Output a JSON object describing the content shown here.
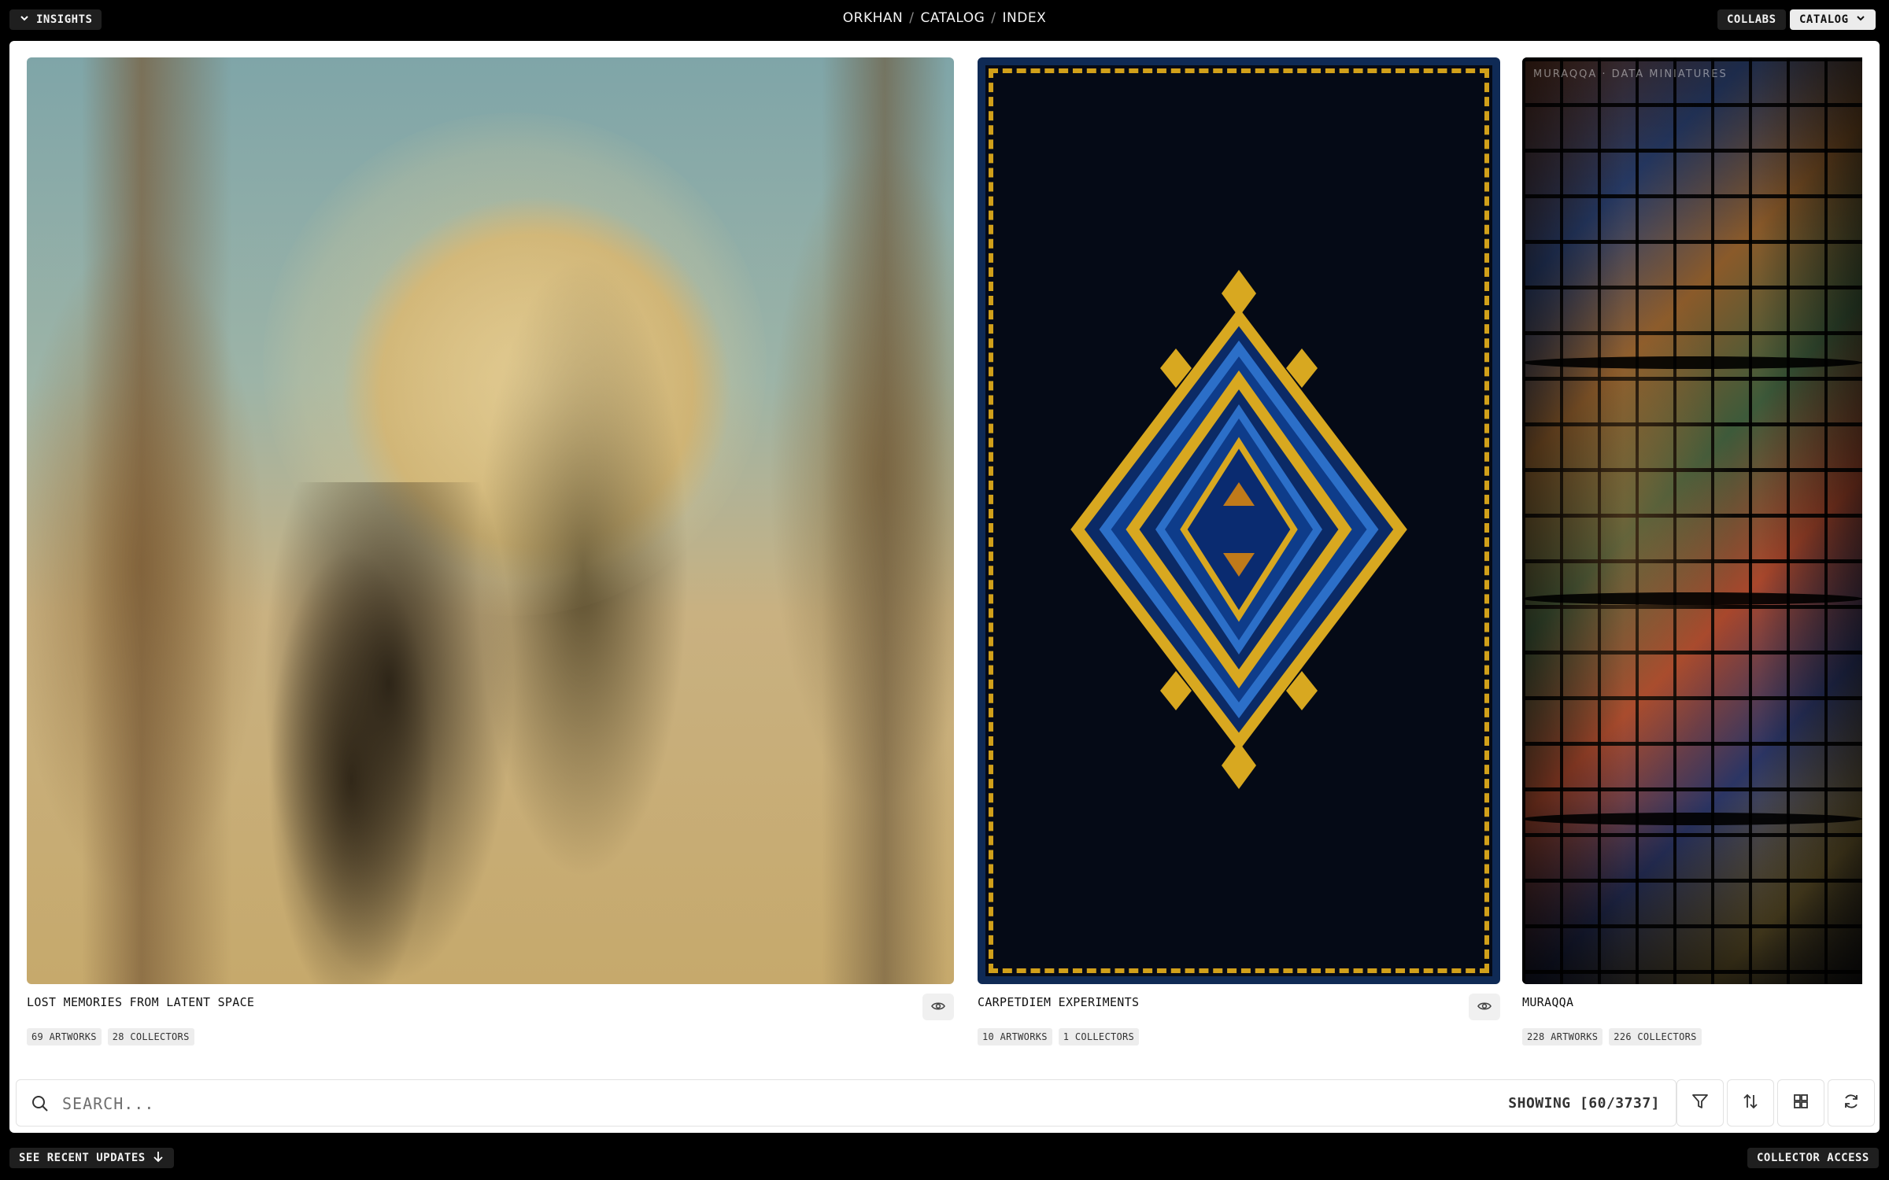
{
  "topbar": {
    "insights_label": "INSIGHTS",
    "breadcrumb": [
      "ORKHAN",
      "CATALOG",
      "INDEX"
    ],
    "collabs_label": "COLLABS",
    "catalog_label": "CATALOG"
  },
  "collections": [
    {
      "title": "LOST MEMORIES FROM LATENT SPACE",
      "artworks": "69 ARTWORKS",
      "collectors": "28 COLLECTORS"
    },
    {
      "title": "CARPETDIEM EXPERIMENTS",
      "artworks": "10 ARTWORKS",
      "collectors": "1 COLLECTORS"
    },
    {
      "title": "MURAQQA",
      "artworks": "228 ARTWORKS",
      "collectors": "226 COLLECTORS",
      "watermark": "MURAQQA · DATA MINIATURES"
    }
  ],
  "search": {
    "placeholder": "SEARCH...",
    "showing": "SHOWING [60/3737]"
  },
  "footer": {
    "updates_label": "SEE RECENT UPDATES",
    "collector_label": "COLLECTOR ACCESS"
  },
  "icons": {
    "insights": "chevron-down-icon",
    "catalog": "chevron-down-icon",
    "view": "eye-icon",
    "search": "search-icon",
    "filter": "filter-icon",
    "sort": "sort-icon",
    "grid": "grid-icon",
    "refresh": "refresh-icon",
    "updates": "arrow-down-icon"
  },
  "colors": {
    "background": "#000000",
    "panel": "#ffffff",
    "pill_dark": "#1f1f1f",
    "pill_light": "#ececec"
  }
}
